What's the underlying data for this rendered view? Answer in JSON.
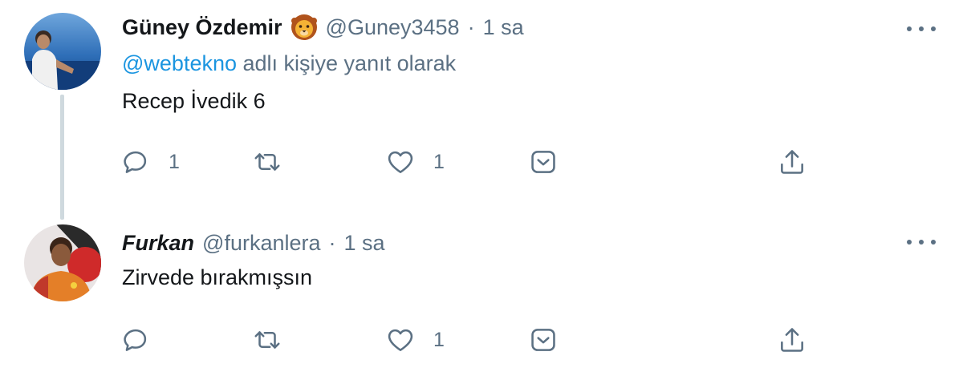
{
  "tweets": [
    {
      "display_name": "Güney Özdemir",
      "badge_icon": "lion-emoji-icon",
      "handle": "@Guney3458",
      "separator": "·",
      "time": "1 sa",
      "reply_prefix": "",
      "reply_mention": "@webtekno",
      "reply_suffix": " adlı kişiye yanıt olarak",
      "text": "Recep İvedik 6",
      "reply_count": "1",
      "retweet_count": "",
      "like_count": "1"
    },
    {
      "display_name": "Furkan",
      "handle": "@furkanlera",
      "separator": "·",
      "time": "1 sa",
      "text": "Zirvede bırakmışsın",
      "reply_count": "",
      "retweet_count": "",
      "like_count": "1"
    }
  ],
  "colors": {
    "text": "#14171a",
    "secondary": "#5b7083",
    "link": "#1b95e0",
    "thread_line": "#cfd9de"
  },
  "icons": [
    "reply-icon",
    "retweet-icon",
    "like-icon",
    "save-icon",
    "share-icon",
    "more-options-icon"
  ]
}
